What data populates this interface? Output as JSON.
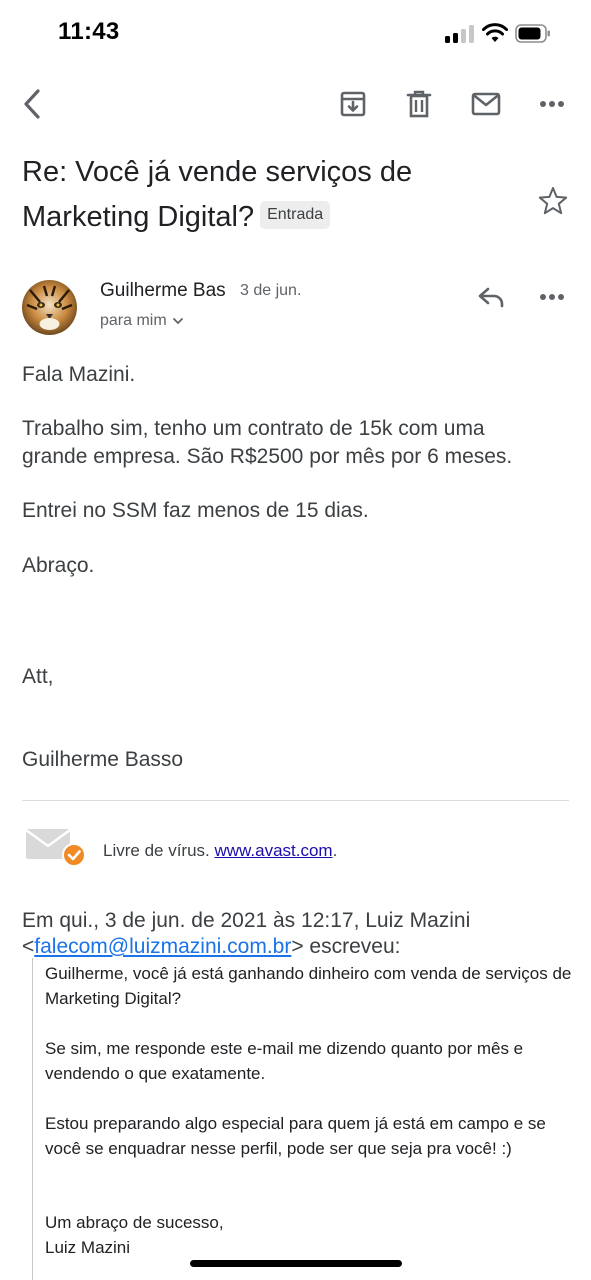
{
  "status_bar": {
    "time": "11:43"
  },
  "toolbar": {
    "back_icon": "chevron-left-icon",
    "archive_icon": "archive-icon",
    "delete_icon": "trash-icon",
    "mark_unread_icon": "mail-icon",
    "more_icon": "more-horizontal-icon"
  },
  "email": {
    "subject": "Re: Você já vende serviços de Marketing Digital?",
    "label": "Entrada",
    "sender_name": "Guilherme Bas",
    "date": "3 de jun.",
    "recipient": "para mim",
    "body": {
      "greeting": "Fala Mazini.",
      "paragraph1": "Trabalho sim, tenho um contrato de 15k com uma grande empresa. São R$2500 por mês por 6 meses.",
      "paragraph2": "Entrei no SSM faz menos de 15 dias.",
      "closing": "Abraço.",
      "att": "Att,",
      "signature": "Guilherme Basso"
    },
    "virus": {
      "text": "Livre de vírus.",
      "link": "www.avast.com",
      "suffix": "."
    },
    "quote": {
      "header_prefix": "Em qui., 3 de jun. de 2021 às 12:17, Luiz Mazini <",
      "header_email": "falecom@luizmazini.com.br",
      "header_suffix": "> escreveu:",
      "p1": "Guilherme, você já está ganhando dinheiro com venda de serviços de Marketing Digital?",
      "p2": "Se sim, me responde este e-mail me dizendo quanto por mês e vendendo o que exatamente.",
      "p3": "Estou preparando algo especial para quem já está em campo e se você se enquadrar nesse perfil, pode ser que seja pra você! :)",
      "p4_line1": "Um abraço de sucesso,",
      "p4_line2": "Luiz Mazini"
    }
  },
  "colors": {
    "text_primary": "#202124",
    "text_secondary": "#5f6368",
    "link": "#1a0dab",
    "avast_orange": "#f08a24"
  }
}
